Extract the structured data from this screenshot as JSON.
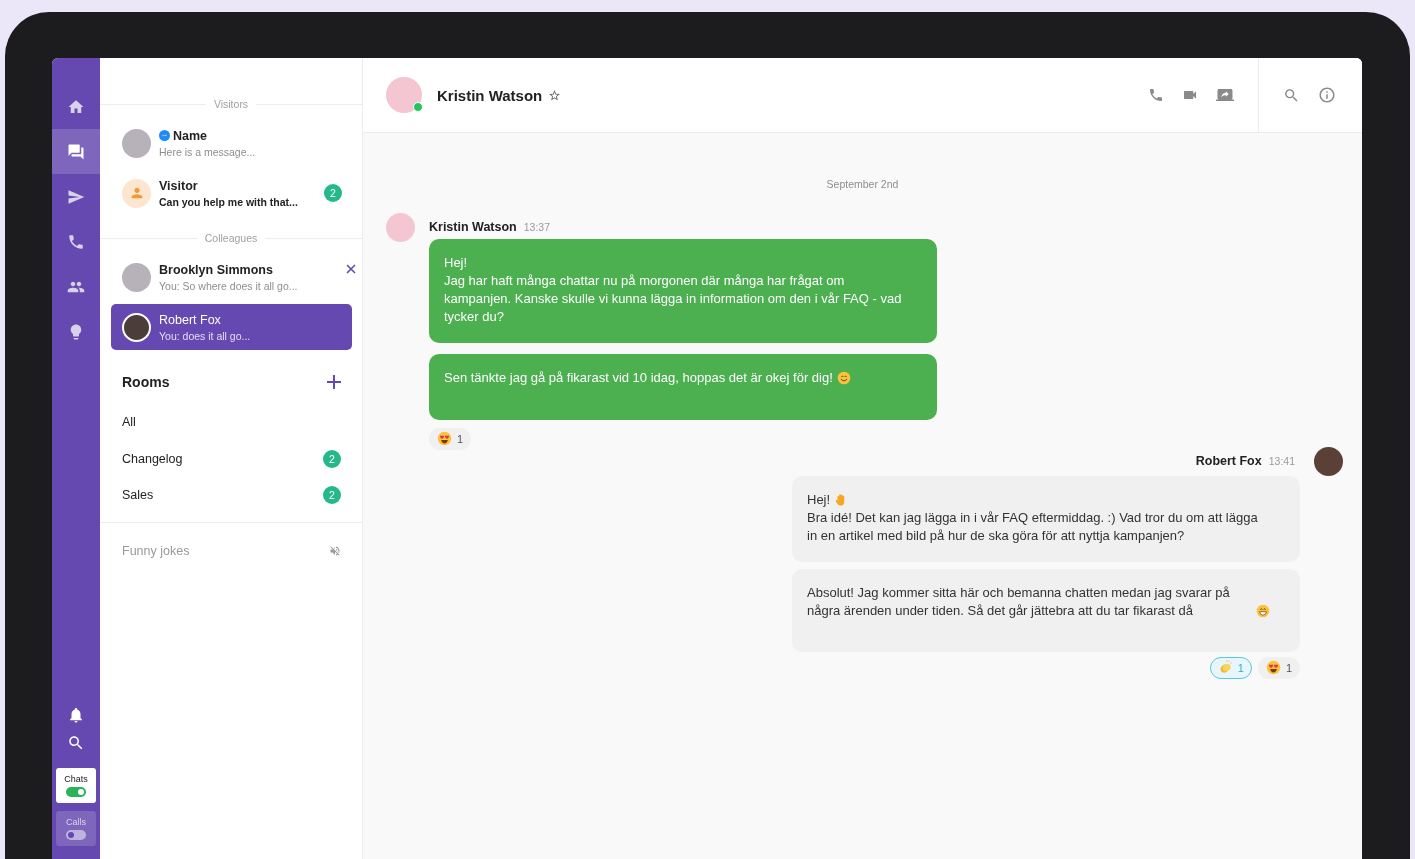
{
  "nav": {
    "items": [
      {
        "kind": "home",
        "selected": false
      },
      {
        "kind": "chats",
        "selected": true
      },
      {
        "kind": "send",
        "selected": false
      },
      {
        "kind": "phone",
        "selected": false
      },
      {
        "kind": "people",
        "selected": false
      },
      {
        "kind": "bulb",
        "selected": false
      }
    ],
    "tools": [
      {
        "kind": "bell"
      },
      {
        "kind": "search"
      }
    ],
    "modes": [
      {
        "label": "Chats",
        "on": true
      },
      {
        "label": "Calls",
        "on": false
      }
    ]
  },
  "conversations": {
    "sections": [
      {
        "heading": "Visitors",
        "items": [
          {
            "kind": "messenger",
            "name": "Name",
            "preview": "Here is a message...",
            "unread": false,
            "selected": false,
            "closable": false
          },
          {
            "kind": "visitor",
            "name": "Visitor",
            "preview": "Can you help me with that...",
            "unread": true,
            "badge": "2",
            "selected": false,
            "closable": false
          }
        ]
      },
      {
        "heading": "Colleagues",
        "items": [
          {
            "kind": "colleague",
            "name": "Brooklyn Simmons",
            "preview": "You: So where does it all go...",
            "unread": false,
            "selected": false,
            "closable": true
          },
          {
            "kind": "colleague",
            "name": "Robert Fox",
            "preview": "You: does it all go...",
            "unread": false,
            "selected": true,
            "closable": false
          }
        ]
      }
    ],
    "rooms": {
      "heading": "Rooms",
      "items": [
        {
          "name": "All"
        },
        {
          "name": "Changelog",
          "badge": "2"
        },
        {
          "name": "Sales",
          "badge": "2"
        }
      ]
    },
    "muted_rooms": [
      {
        "name": "Funny jokes",
        "muted": true
      }
    ]
  },
  "chat": {
    "contact": {
      "name": "Kristin Watson",
      "online": true,
      "starred": false
    },
    "date": "September 2nd",
    "groups": [
      {
        "kind": "left",
        "author": "Kristin Watson",
        "time": "13:37",
        "bubbles": [
          {
            "paragraphs": [
              {
                "text": "Hej!"
              },
              {
                "text": "Jag har haft många chattar nu på morgonen där många har frågat om kampanjen. Kanske skulle vi kunna lägga in information om den i vår FAQ - vad tycker du?"
              }
            ]
          },
          {
            "paragraphs": [
              {
                "text": "Sen tänkte jag gå på fikarast vid 10 idag, hoppas det är okej för dig!",
                "emoji": {
                  "kind": "smile"
                }
              }
            ]
          }
        ],
        "reactions": [
          {
            "kind": "heart-eyes",
            "count": "1",
            "selected": false
          }
        ]
      },
      {
        "kind": "right",
        "author": "Robert Fox",
        "time": "13:41",
        "bubbles": [
          {
            "paragraphs": [
              {
                "text": "Hej!",
                "emoji": {
                  "kind": "raised-hand"
                }
              },
              {
                "text": "Bra idé! Det kan jag lägga in i vår FAQ eftermiddag. :) Vad tror du om att lägga in en artikel med bild på hur de ska göra för att nyttja kampanjen?"
              }
            ]
          },
          {
            "paragraphs": [
              {
                "text": "Absolut! Jag kommer sitta här och bemanna chatten medan jag svarar på några ärenden under tiden. Så det går jättebra att du tar fikarast då",
                "emoji": {
                  "kind": "grin"
                }
              }
            ]
          }
        ],
        "reactions": [
          {
            "kind": "clap",
            "count": "1",
            "selected": true
          },
          {
            "kind": "heart-eyes",
            "count": "1",
            "selected": false
          }
        ]
      }
    ]
  }
}
